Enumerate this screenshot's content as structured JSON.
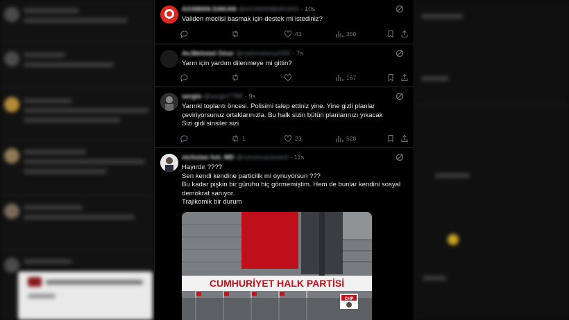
{
  "tweets": [
    {
      "name": "AXAMAN DAKAN",
      "handle": "@AXAMANBAKAN3",
      "time": "· 10s",
      "text": "Validen meclisi basmak için destek mi istediniz?",
      "replies": "",
      "retweets": "",
      "likes": "43",
      "views": "350"
    },
    {
      "name": "Av.Mehmet Onur",
      "handle": "@mehmetonur000",
      "time": "· 7s",
      "text": "Yarın için yardım dilenmeye mi gittin?",
      "replies": "",
      "retweets": "",
      "likes": "",
      "views": "167"
    },
    {
      "name": "sergio",
      "handle": "@sergio7788",
      "time": "· 9s",
      "text": "Yarınki toplantı öncesi. Polisimi talep ettiniz yine. Yine gizli planlar\nçeviriyorsunuz ortaklarınızla. Bu halk sizin bütün planlarınızı yıkacak\nSizi gidi sinsiler sizi",
      "replies": "",
      "retweets": "1",
      "likes": "23",
      "views": "528"
    },
    {
      "name": "nicholas hol, MD",
      "handle": "@norumusclurent",
      "time": "· 11s",
      "text": "Hayırdır ????\nSen kendi kendine particilik mi oynuyorsun ???\nBu kadar pişkin bir güruhu hiç görmemiştim. Hem de bunlar kendini sosyal\ndemokrat sanıyor.\nTrajikomik bir durum",
      "image": {
        "sign_text": "CUMHURİYET HALK PARTİSİ",
        "chp_badge": "CHP"
      }
    }
  ],
  "icons": {
    "more": "grok-icon",
    "reply": "reply-icon",
    "retweet": "retweet-icon",
    "like": "heart-icon",
    "views": "views-icon",
    "bookmark": "bookmark-icon",
    "share": "share-icon"
  },
  "colors": {
    "background": "#000000",
    "text": "#e7e9ea",
    "muted": "#71767b",
    "divider": "#2f3336",
    "banner_red": "#c8101b"
  }
}
